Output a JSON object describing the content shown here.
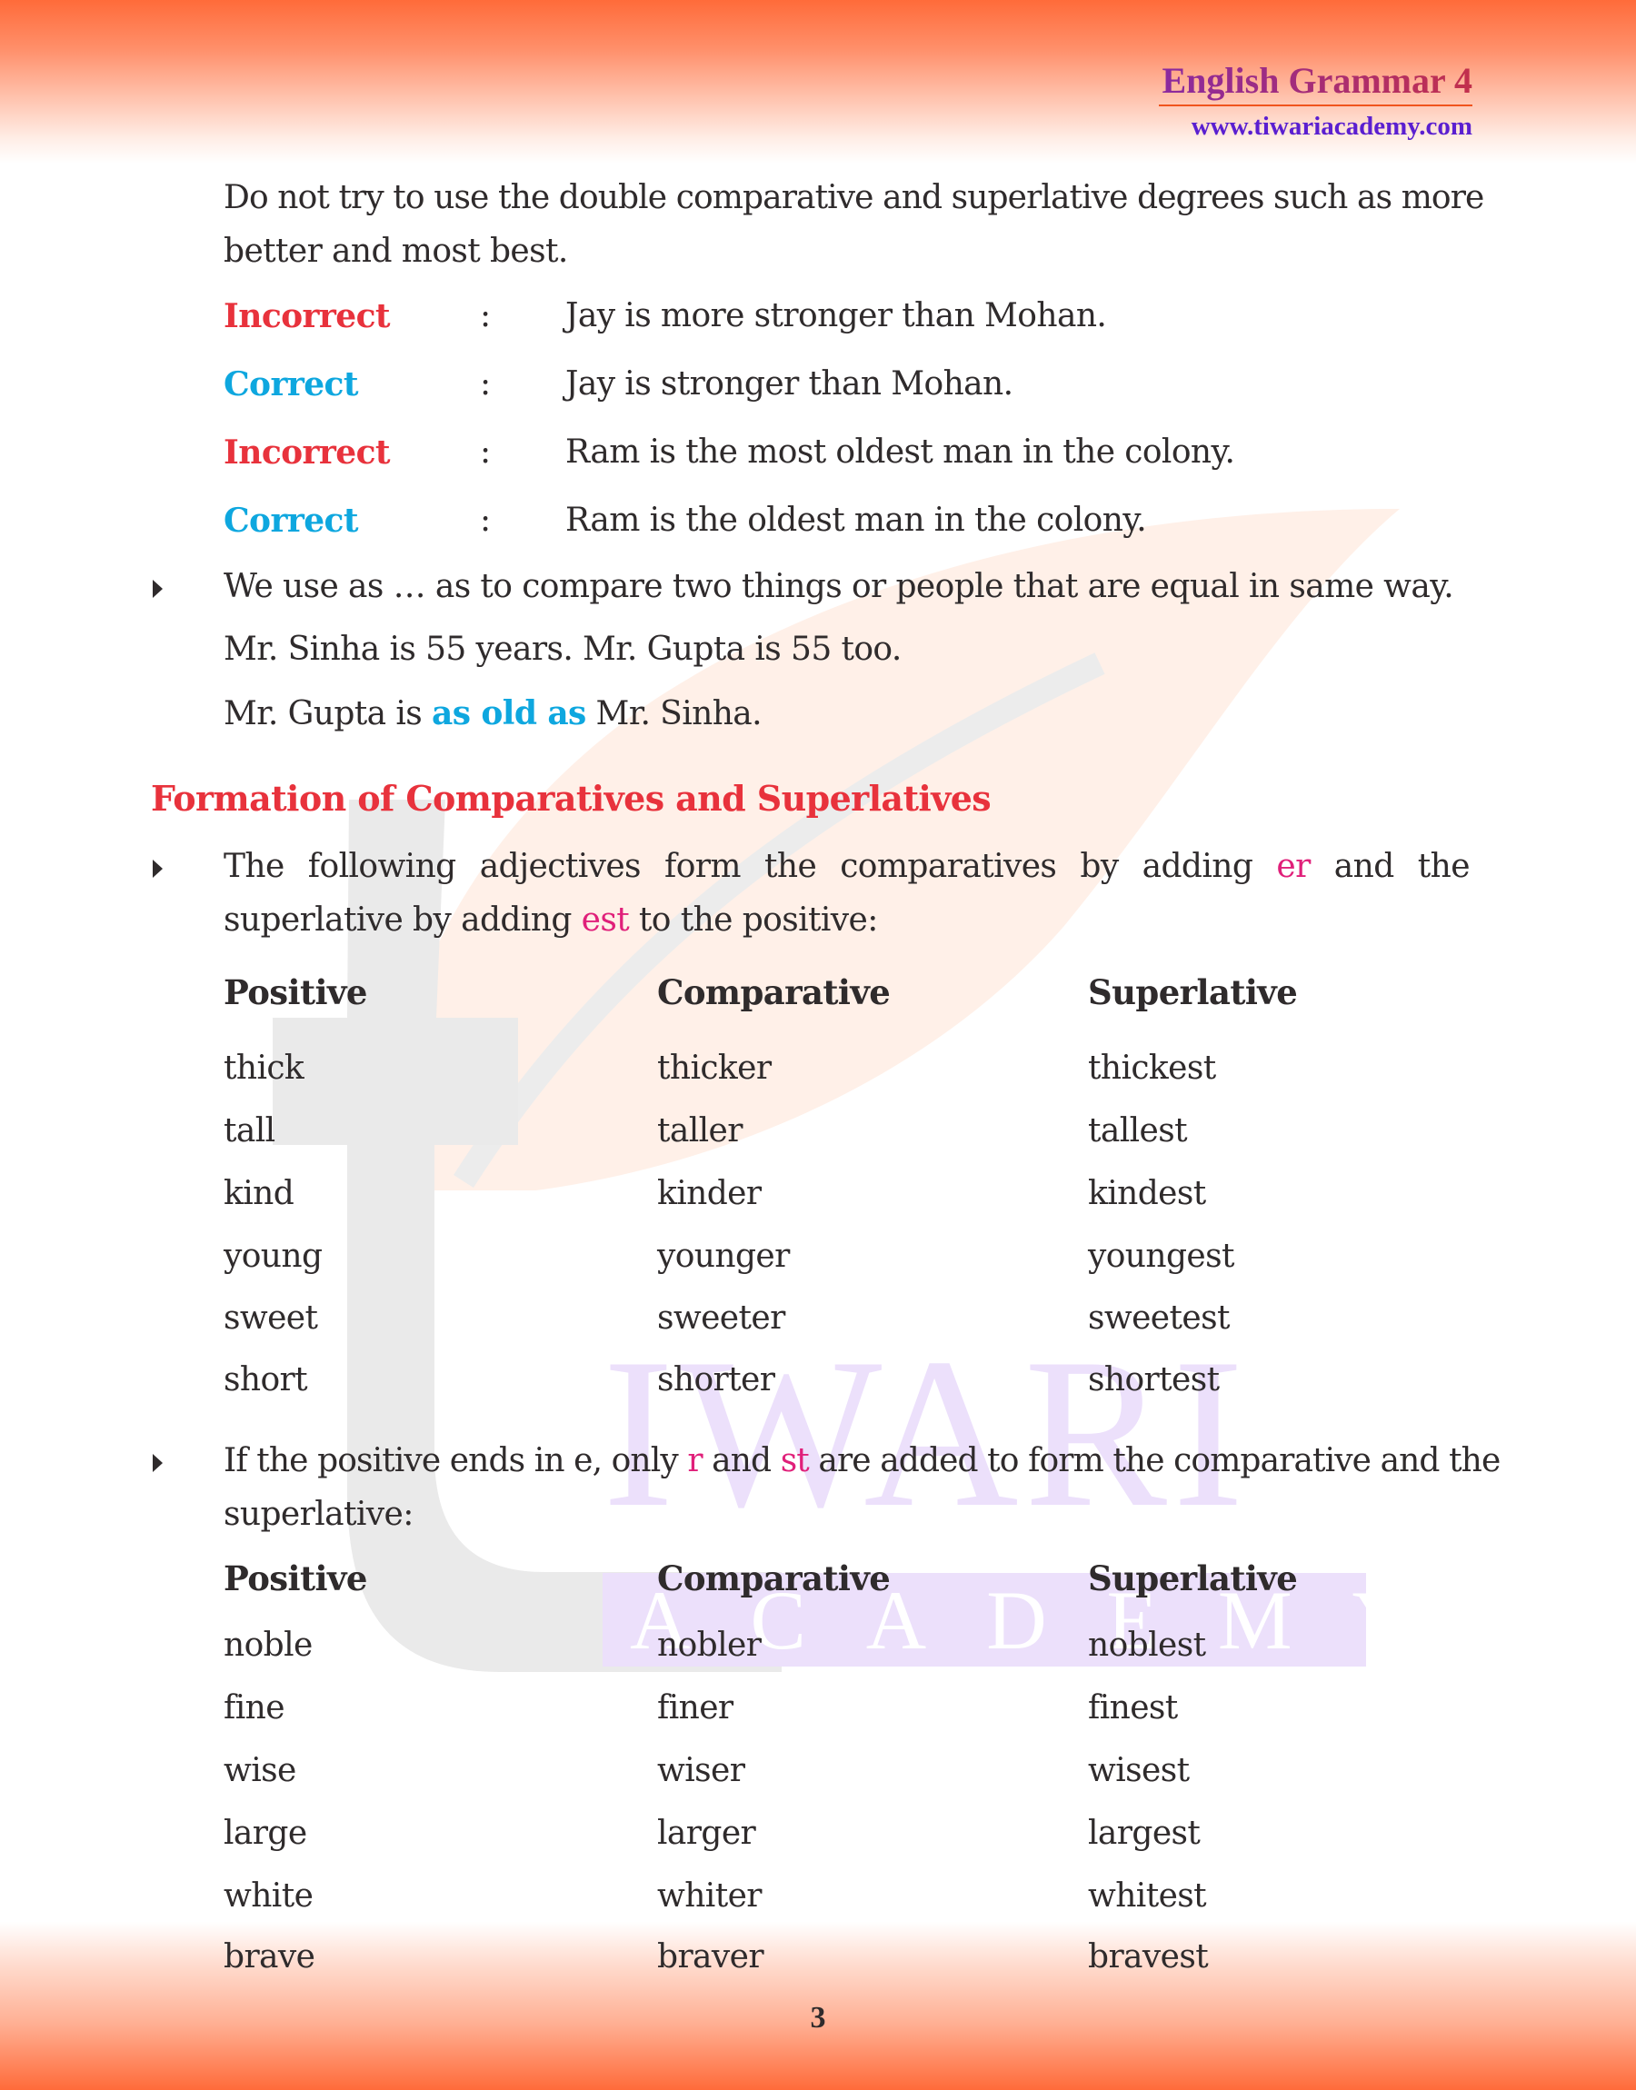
{
  "header": {
    "title": "English Grammar 4",
    "url": "www.tiwariacademy.com"
  },
  "watermark": {
    "word1": "IWARI",
    "word2": "ACADEMY"
  },
  "intro": {
    "line1": "Do not try to use the double comparative and superlative degrees such as more",
    "line2": "better and most best."
  },
  "examples": [
    {
      "label": "Incorrect",
      "sep": ":",
      "sentence": "Jay is more stronger than Mohan."
    },
    {
      "label": "Correct",
      "sep": ":",
      "sentence": "Jay is stronger than Mohan."
    },
    {
      "label": "Incorrect",
      "sep": ":",
      "sentence": "Ram is the most oldest man in the colony."
    },
    {
      "label": "Correct",
      "sep": ":",
      "sentence": "Ram is the oldest man in the colony."
    }
  ],
  "as_as": {
    "bullet_text": "We use as … as to compare two things or people that are equal in same way.",
    "example1": "Mr. Sinha is 55 years. Mr. Gupta is 55 too.",
    "example2_pre": "Mr. Gupta is ",
    "example2_highlight": "as old as",
    "example2_post": " Mr. Sinha."
  },
  "section": {
    "heading": "Formation of Comparatives and Superlatives",
    "rule1": {
      "words": [
        "The",
        "following",
        "adjectives",
        "form",
        "the",
        "comparatives",
        "by",
        "adding",
        "er",
        "and",
        "the"
      ],
      "highlight_index": 8,
      "line2_pre": "superlative by adding ",
      "line2_highlight": "est",
      "line2_post": " to the positive:"
    },
    "table1": {
      "headers": [
        "Positive",
        "Comparative",
        "Superlative"
      ],
      "rows": [
        [
          "thick",
          "thicker",
          "thickest"
        ],
        [
          "tall",
          "taller",
          "tallest"
        ],
        [
          "kind",
          "kinder",
          "kindest"
        ],
        [
          "young",
          "younger",
          "youngest"
        ],
        [
          "sweet",
          "sweeter",
          "sweetest"
        ],
        [
          "short",
          "shorter",
          "shortest"
        ]
      ]
    },
    "rule2": {
      "line1_pre": "If the positive ends in e, only ",
      "line1_hl1": "r",
      "line1_mid": " and ",
      "line1_hl2": "st",
      "line1_post": " are added to form the comparative and the",
      "line2": "superlative:"
    },
    "table2": {
      "headers": [
        "Positive",
        "Comparative",
        "Superlative"
      ],
      "rows": [
        [
          "noble",
          "nobler",
          "noblest"
        ],
        [
          "fine",
          "finer",
          "finest"
        ],
        [
          "wise",
          "wiser",
          "wisest"
        ],
        [
          "large",
          "larger",
          "largest"
        ],
        [
          "white",
          "whiter",
          "whitest"
        ],
        [
          "brave",
          "braver",
          "bravest"
        ]
      ]
    }
  },
  "footer": {
    "page_number": "3"
  },
  "colors": {
    "incorrect": "#e8323c",
    "correct": "#0ea7df",
    "suffix_highlight": "#e0207a",
    "heading": "#e8323c",
    "header_band": "#ff6b3a"
  }
}
